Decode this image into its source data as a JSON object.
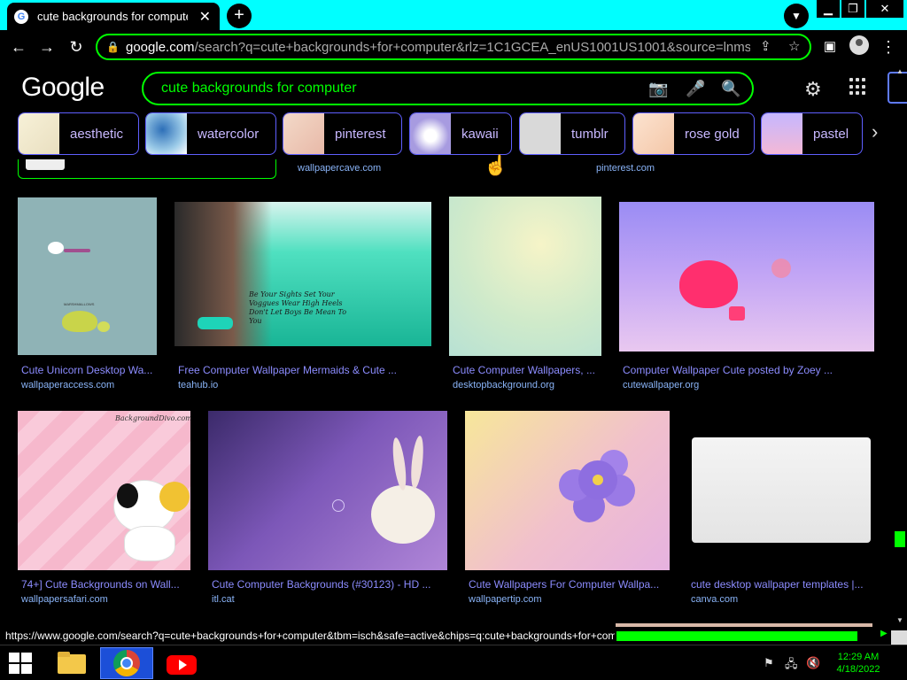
{
  "browser": {
    "tab_title": "cute backgrounds for computer - Google Search",
    "tab_favicon": "G",
    "url_host": "google.com",
    "url_rest": "/search?q=cute+backgrounds+for+computer&rlz=1C1GCEA_enUS1001US1001&source=lnms&tbm=isch&sa=X",
    "window_controls": {
      "minimize": "▁",
      "restore": "❐",
      "close": "✕"
    }
  },
  "google": {
    "logo_text": "Google",
    "query": "cute backgrounds for computer"
  },
  "chips": [
    {
      "label": "aesthetic"
    },
    {
      "label": "watercolor"
    },
    {
      "label": "pinterest"
    },
    {
      "label": "kawaii"
    },
    {
      "label": "tumblr"
    },
    {
      "label": "rose gold"
    },
    {
      "label": "pastel"
    }
  ],
  "top_sources": [
    "wallpapercave.com",
    "pinterest.com"
  ],
  "results": [
    {
      "title": "Cute Unicorn Desktop Wa...",
      "source": "wallpaperaccess.com"
    },
    {
      "title": "Free Computer Wallpaper Mermaids & Cute ...",
      "source": "teahub.io"
    },
    {
      "title": "Cute Computer Wallpapers, ...",
      "source": "desktopbackground.org"
    },
    {
      "title": "Computer Wallpaper Cute posted by Zoey ...",
      "source": "cutewallpaper.org"
    },
    {
      "title": "74+] Cute Backgrounds on Wall...",
      "source": "wallpapersafari.com"
    },
    {
      "title": "Cute Computer Backgrounds (#30123) - HD ...",
      "source": "itl.cat"
    },
    {
      "title": "Cute Wallpapers For Computer Wallpa...",
      "source": "wallpapertip.com"
    },
    {
      "title": "cute desktop wallpaper templates |...",
      "source": "canva.com"
    }
  ],
  "image_text": {
    "unicorn_word": "MARSHMALLOWS",
    "mermaid_quote": "Be Your Sights Set Your Voggues Wear High Heels Don't Let Boys Be Mean To You",
    "dog_site": "BackgroundDivo.com"
  },
  "status_url": "https://www.google.com/search?q=cute+backgrounds+for+computer&tbm=isch&safe=active&chips=q:cute+backgrounds+for+computer,online_chips:kawaii",
  "taskbar": {
    "time": "12:29 AM",
    "date": "4/18/2022"
  },
  "colors": {
    "accent": "#00ff00",
    "tab_strip": "#00ffff",
    "link": "#8ab4f8",
    "caption": "#8c8cff"
  }
}
